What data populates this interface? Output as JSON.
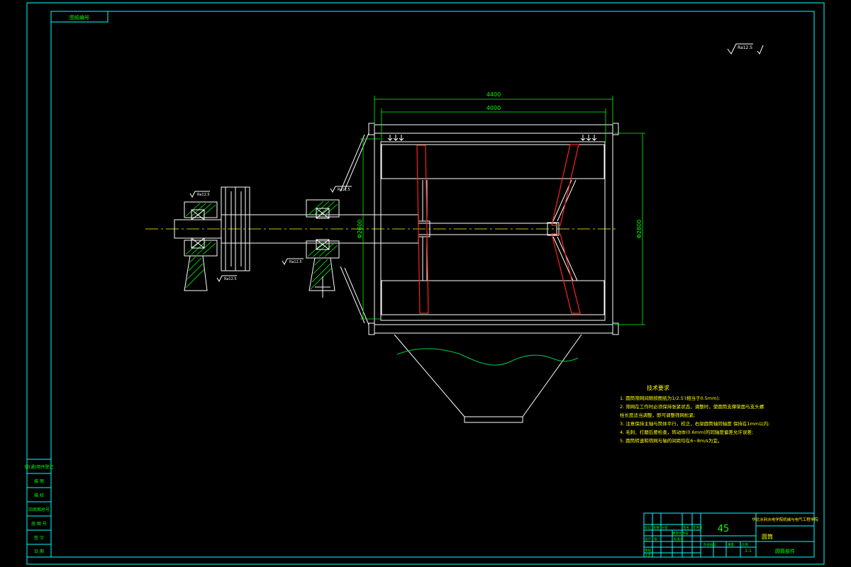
{
  "sheet": {
    "corner_tag": "图纸编号",
    "surface_finish_global": "Ra12.5",
    "colors": {
      "background": "#000000",
      "frame": "#00ffff",
      "outline": "#ffffff",
      "dimension": "#00ff00",
      "hatch": "#00ff00",
      "paddle": "#ff2020",
      "wave": "#00cc44",
      "annotation": "#ffff00"
    }
  },
  "dimensions": {
    "overall_length": "4400",
    "inner_length": "4000",
    "height_left": "Φ2600",
    "height_right": "Φ2800"
  },
  "roughness_marks": {
    "left_bearing": "Ra12.5",
    "left_bearing_bottom": "Ra12.5",
    "right_bearing_top": "Ra12.5",
    "right_bearing_left": "Ra12.5"
  },
  "tech_notes": {
    "title": "技术要求",
    "lines": [
      "1. 圆筒筛网间隙按图纸为1/2.5′(相当于0.5mm);",
      "2. 筛网在工作时必须保持张紧状态，调整时，使圆筒支撑架面与支头螺",
      "   栓长度适当调整，即可调整筛网松紧;",
      "3. 注意保持主轴与筒体平行，校正，右梁圆筒轴同轴度    保持在1mm以内;",
      "4. 毛刺、打磨后要检查，转动体(0.6mm)的同轴度偏差允许误差;",
      "5. 圆筒转速和筛网与轴的间距均在6~8m/s为宜。"
    ]
  },
  "left_table": {
    "rows": [
      "借(通)用件登记",
      "描 图",
      "描 校",
      "旧底图总号",
      "底 图 号",
      "签 字",
      "日 期"
    ]
  },
  "title_block": {
    "material": "45",
    "school": "华北水利水电学院机械与电气工程学院",
    "part_name": "圆筒",
    "scale": "1:1",
    "drawing_no": "圆筒部件",
    "rows": [
      "标记",
      "处数",
      "分区",
      "更改文件号",
      "签名",
      "年月日"
    ],
    "roles": [
      "设计",
      "审核",
      "工艺"
    ],
    "sub_headers": [
      "阶段标记",
      "重量",
      "比例"
    ],
    "designer_tag": "张一",
    "standard_tag": "标准化"
  }
}
